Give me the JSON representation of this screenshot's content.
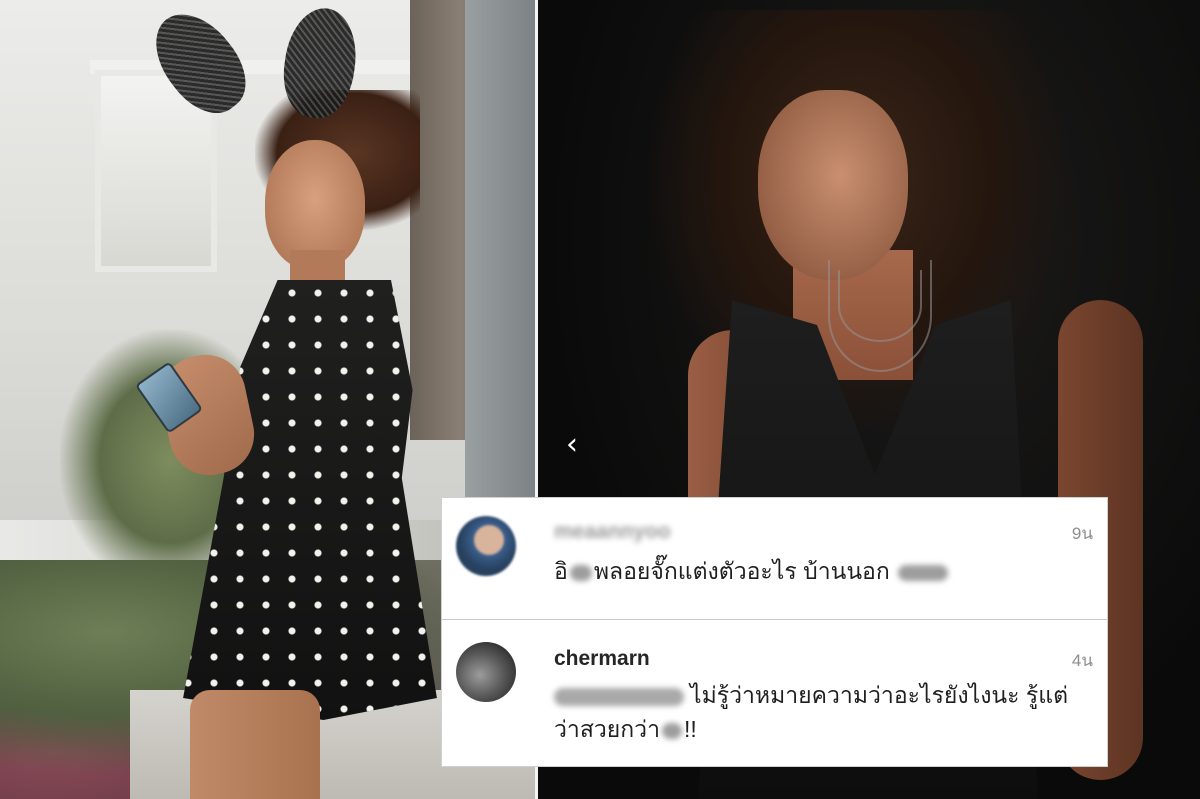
{
  "comments": [
    {
      "username": "meaannyoo",
      "time": "9น",
      "text_a": "อิ",
      "text_b": "พลอยจั๊กแต่งตัวอะไร บ้านนอก"
    },
    {
      "username": "chermarn",
      "time": "4น",
      "text_a": "ไม่รู้ว่าหมายความว่าอะไรยังไงนะ รู้แต่ว่าสวยกว่า",
      "text_b": "!!"
    }
  ],
  "navigation": {
    "back_icon": "chevron-left-icon",
    "back_glyph": "‹"
  },
  "colors": {
    "overlay_bg": "#ffffff",
    "username": "#262626",
    "timestamp": "#8e8e8e",
    "divider": "#f4f4f4"
  }
}
